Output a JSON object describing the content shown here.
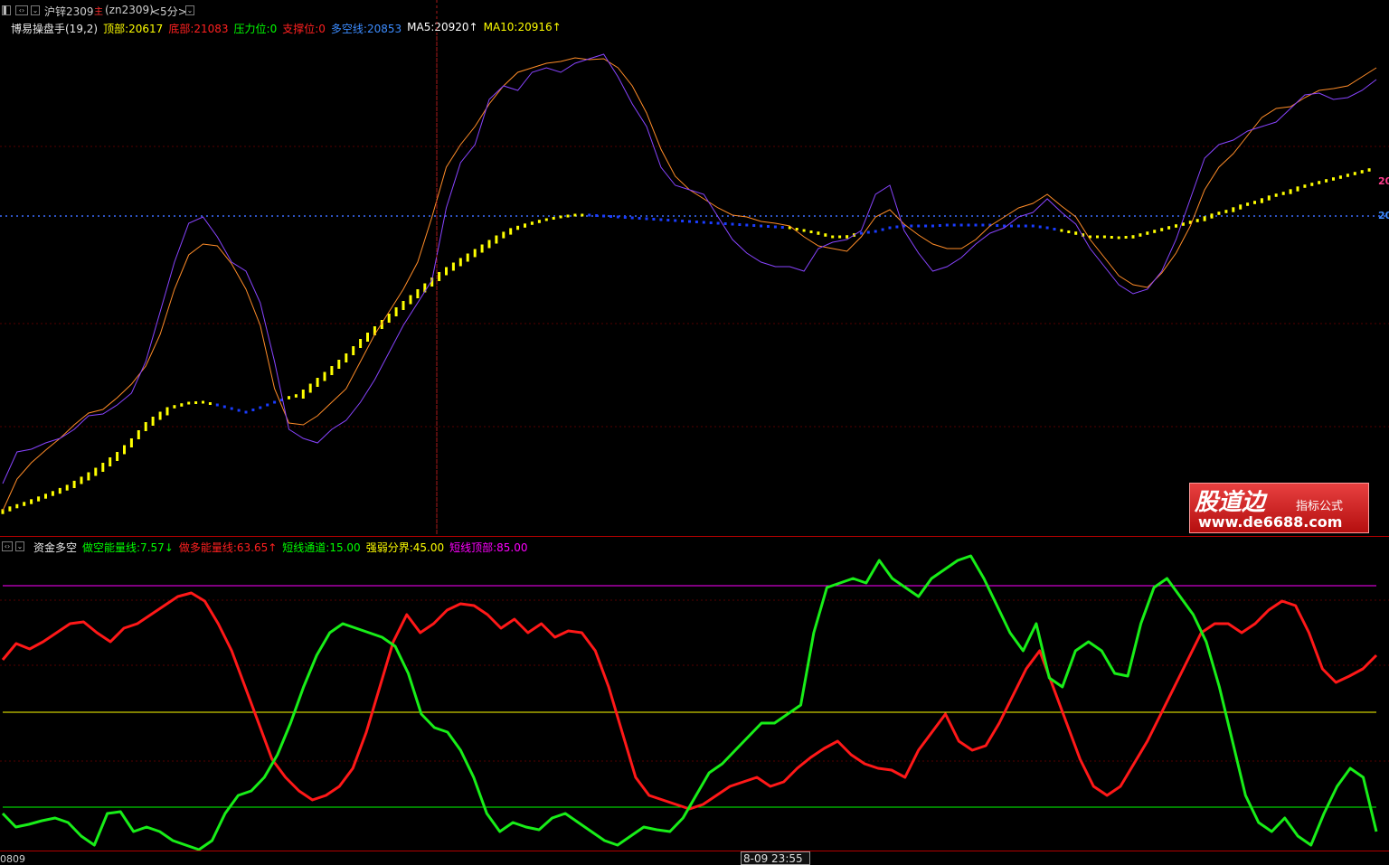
{
  "main_header": {
    "symbol": "沪锌2309",
    "symbol_mark": "主",
    "symbol_code": "(zn2309)",
    "period": "<5分>"
  },
  "main_indicator": {
    "name": "博易操盘手(19,2)",
    "items": [
      {
        "text": "顶部:20617",
        "color": "#ffff00"
      },
      {
        "text": "底部:21083",
        "color": "#ff2020"
      },
      {
        "text": "压力位:0",
        "color": "#00ff00"
      },
      {
        "text": "支撑位:0",
        "color": "#ff2020"
      },
      {
        "text": "多空线:20853",
        "color": "#3c8cff"
      },
      {
        "text": "MA5:20920↑",
        "color": "#ffffff"
      },
      {
        "text": "MA10:20916↑",
        "color": "#ffff00"
      }
    ],
    "right_labels": [
      {
        "text": "20",
        "color": "#ff3c8c"
      },
      {
        "text": "20",
        "color": "#3c8cff"
      }
    ]
  },
  "sub_indicator": {
    "name": "资金多空",
    "items": [
      {
        "text": "做空能量线:7.57↓",
        "color": "#00ff00"
      },
      {
        "text": "做多能量线:63.65↑",
        "color": "#ff2020"
      },
      {
        "text": "短线通道:15.00",
        "color": "#00ff00"
      },
      {
        "text": "强弱分界:45.00",
        "color": "#ffff00"
      },
      {
        "text": "短线顶部:85.00",
        "color": "#ff00ff"
      }
    ]
  },
  "watermark": {
    "logo_text": "股道边",
    "tag": "指标公式",
    "url": "www.de6688.com"
  },
  "time_axis": {
    "left_label": "0809",
    "cursor_label": "8-09 23:55"
  },
  "colors": {
    "ma5": "#8844ff",
    "ma10": "#ff8c28",
    "trend": "#ffff00",
    "trend_down": "#1a3cff",
    "short_energy": "#18ee18",
    "long_energy": "#ff1818",
    "top_line": "#ff00ff",
    "mid_line": "#ffff00",
    "channel_line": "#00ff00"
  },
  "chart_data": {
    "type": "line",
    "panels": [
      {
        "name": "博易操盘手(19,2)",
        "series": [
          {
            "name": "MA5",
            "values": [
              535,
              500,
              497,
              490,
              485,
              475,
              460,
              458,
              448,
              435,
              400,
              345,
              290,
              247,
              240,
              262,
              290,
              300,
              335,
              400,
              475,
              485,
              490,
              475,
              465,
              445,
              420,
              390,
              360,
              335,
              310,
              230,
              180,
              160,
              110,
              95,
              100,
              80,
              75,
              80,
              70,
              65,
              60,
              85,
              115,
              140,
              185,
              205,
              210,
              215,
              240,
              265,
              280,
              290,
              295,
              295,
              300,
              275,
              268,
              265,
              255,
              215,
              205,
              255,
              280,
              300,
              295,
              285,
              270,
              258,
              252,
              240,
              235,
              220,
              235,
              248,
              275,
              295,
              315,
              325,
              320,
              300,
              265,
              220,
              175,
              160,
              155,
              145,
              140,
              135,
              120,
              105,
              103,
              110,
              108,
              100,
              88
            ]
          },
          {
            "name": "MA10",
            "values": [
              565,
              530,
              512,
              498,
              485,
              470,
              457,
              453,
              440,
              425,
              405,
              370,
              320,
              282,
              270,
              272,
              292,
              320,
              360,
              430,
              468,
              470,
              460,
              445,
              430,
              400,
              370,
              345,
              320,
              290,
              240,
              185,
              160,
              140,
              115,
              95,
              80,
              75,
              70,
              68,
              64,
              66,
              65,
              75,
              95,
              125,
              165,
              195,
              210,
              220,
              230,
              238,
              240,
              245,
              247,
              250,
              262,
              272,
              275,
              278,
              262,
              240,
              232,
              248,
              260,
              270,
              275,
              275,
              265,
              250,
              240,
              230,
              225,
              215,
              228,
              240,
              265,
              285,
              305,
              315,
              318,
              302,
              280,
              250,
              210,
              185,
              170,
              150,
              130,
              120,
              118,
              108,
              100,
              98,
              95,
              85,
              75
            ]
          },
          {
            "name": "多空线",
            "values": [
              566,
              560,
              555,
              549,
              543,
              536,
              527,
              517,
              505,
              490,
              472,
              460,
              450,
              446,
              445,
              448,
              452,
              456,
              451,
              445,
              440,
              436,
              423,
              410,
              396,
              380,
              366,
              352,
              338,
              325,
              312,
              300,
              290,
              280,
              270,
              260,
              252,
              247,
              243,
              240,
              238,
              238,
              239,
              240,
              241,
              242,
              243,
              244,
              245,
              246,
              247,
              248,
              249,
              250,
              251,
              252,
              255,
              258,
              262,
              262,
              258,
              256,
              252,
              250,
              250,
              250,
              249,
              249,
              249,
              249,
              250,
              250,
              250,
              252,
              255,
              258,
              262,
              262,
              263,
              262,
              258,
              254,
              250,
              246,
              242,
              236,
              232,
              226,
              222,
              216,
              212,
              206,
              202,
              198,
              194,
              190,
              186
            ],
            "colors": [
              "up",
              "up",
              "up",
              "up",
              "up",
              "up",
              "up",
              "up",
              "up",
              "up",
              "up",
              "up",
              "up",
              "up",
              "up",
              "down",
              "down",
              "down",
              "down",
              "down",
              "up",
              "up",
              "up",
              "up",
              "up",
              "up",
              "up",
              "up",
              "up",
              "up",
              "up",
              "up",
              "up",
              "up",
              "up",
              "up",
              "up",
              "up",
              "up",
              "up",
              "up",
              "down",
              "down",
              "down",
              "down",
              "down",
              "down",
              "down",
              "down",
              "down",
              "down",
              "down",
              "down",
              "down",
              "down",
              "up",
              "up",
              "up",
              "up",
              "up",
              "down",
              "down",
              "down",
              "down",
              "down",
              "down",
              "down",
              "down",
              "down",
              "down",
              "down",
              "down",
              "down",
              "down",
              "up",
              "up",
              "up",
              "up",
              "up",
              "up",
              "up",
              "up",
              "up",
              "up",
              "up",
              "up",
              "up",
              "up",
              "up",
              "up",
              "up",
              "up",
              "up",
              "up",
              "up",
              "up"
            ]
          }
        ],
        "horizontal_line": 239
      },
      {
        "name": "资金多空",
        "series": [
          {
            "name": "做空能量线",
            "values": [
              900,
              915,
              912,
              908,
              905,
              910,
              925,
              935,
              900,
              898,
              920,
              915,
              920,
              930,
              935,
              940,
              930,
              900,
              880,
              875,
              860,
              835,
              800,
              760,
              725,
              700,
              690,
              695,
              700,
              705,
              715,
              745,
              790,
              805,
              810,
              830,
              860,
              900,
              920,
              910,
              915,
              918,
              905,
              900,
              910,
              920,
              930,
              935,
              925,
              915,
              918,
              920,
              905,
              880,
              855,
              845,
              830,
              815,
              800,
              800,
              790,
              780,
              700,
              650,
              645,
              640,
              645,
              620,
              640,
              650,
              660,
              640,
              630,
              620,
              615,
              640,
              670,
              700,
              720,
              690,
              750,
              760,
              720,
              710,
              720,
              745,
              748,
              690,
              650,
              640,
              660,
              680,
              710,
              760,
              820,
              880,
              910,
              920,
              905,
              925,
              935,
              900,
              870,
              850,
              860,
              920
            ]
          },
          {
            "name": "做多能量线",
            "values": [
              730,
              712,
              718,
              710,
              700,
              690,
              688,
              700,
              710,
              695,
              690,
              680,
              670,
              660,
              656,
              665,
              690,
              720,
              760,
              800,
              840,
              860,
              875,
              885,
              880,
              870,
              850,
              810,
              760,
              710,
              680,
              700,
              690,
              675,
              668,
              670,
              680,
              695,
              685,
              700,
              690,
              705,
              698,
              700,
              720,
              760,
              810,
              860,
              880,
              885,
              890,
              895,
              890,
              880,
              870,
              865,
              860,
              870,
              865,
              850,
              838,
              828,
              820,
              835,
              845,
              850,
              852,
              860,
              830,
              810,
              790,
              820,
              830,
              825,
              800,
              770,
              740,
              720,
              760,
              800,
              840,
              870,
              880,
              870,
              845,
              820,
              790,
              760,
              730,
              700,
              690,
              690,
              700,
              690,
              675,
              665,
              670,
              700,
              740,
              755,
              748,
              740,
              725
            ]
          }
        ],
        "levels": [
          {
            "name": "短线顶部",
            "value": 85.0
          },
          {
            "name": "强弱分界",
            "value": 45.0
          },
          {
            "name": "短线通道",
            "value": 15.0
          }
        ]
      }
    ]
  }
}
